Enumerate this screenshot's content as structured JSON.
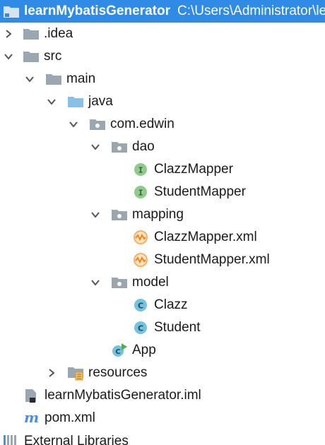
{
  "project": {
    "name": "learnMybatisGenerator",
    "path": "C:\\Users\\Administrator\\le"
  },
  "tree": {
    "idea": ".idea",
    "src": "src",
    "main": "main",
    "java": "java",
    "package": "com.edwin",
    "dao": "dao",
    "clazz_mapper": "ClazzMapper",
    "student_mapper": "StudentMapper",
    "mapping": "mapping",
    "clazz_mapper_xml": "ClazzMapper.xml",
    "student_mapper_xml": "StudentMapper.xml",
    "model": "model",
    "clazz": "Clazz",
    "student": "Student",
    "app": "App",
    "resources": "resources",
    "iml": "learnMybatisGenerator.iml",
    "pom": "pom.xml",
    "external": "External Libraries"
  },
  "colors": {
    "selection": "#2f8be6",
    "folder": "#9aa7b0",
    "source_folder": "#87c2e6",
    "interface_badge": "#8fcc8b",
    "class_badge": "#73c2e0",
    "xml_badge": "#f6b26b"
  }
}
